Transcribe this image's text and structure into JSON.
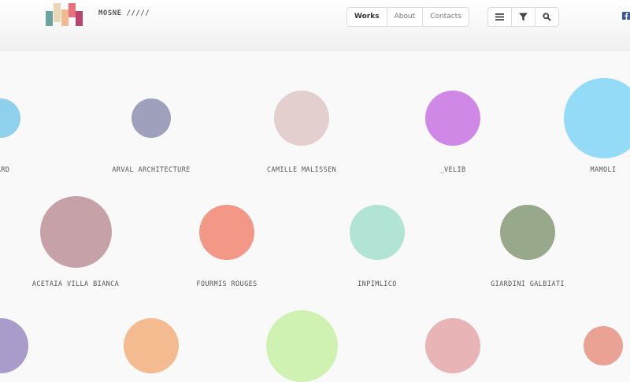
{
  "brand": {
    "name": "MOSNE /////"
  },
  "logo": {
    "colors": [
      "#6aa3a0",
      "#e8d8b8",
      "#f5b990",
      "#e9717c",
      "#b8456d"
    ]
  },
  "nav": {
    "items": [
      {
        "label": "Works",
        "active": true
      },
      {
        "label": "About",
        "active": false
      },
      {
        "label": "Contacts",
        "active": false
      }
    ]
  },
  "toolbar": {
    "menu_icon": "hamburger-icon",
    "filter_icon": "filter-icon",
    "search_icon": "search-icon"
  },
  "social": {
    "facebook_icon": "facebook-icon"
  },
  "works": [
    {
      "label": "ARD",
      "color": "#8fd0ec"
    },
    {
      "label": "ARVAL ARCHITECTURE",
      "color": "#9ea0bc"
    },
    {
      "label": "CAMILLE MALISSEN",
      "color": "#e3cfcd"
    },
    {
      "label": "_VELIB",
      "color": "#cf88e6"
    },
    {
      "label": "MAMOLI",
      "color": "#93dbf7"
    },
    {
      "label": "ACETAIA VILLA BIANCA",
      "color": "#c6a2a8"
    },
    {
      "label": "FOURMIS ROUGES",
      "color": "#f39787"
    },
    {
      "label": "INPIMLICO",
      "color": "#b1e4d4"
    },
    {
      "label": "GIARDINI GALBIATI",
      "color": "#98a88b"
    },
    {
      "label": "",
      "color": "#a99ccb"
    },
    {
      "label": "",
      "color": "#f5bb90"
    },
    {
      "label": "",
      "color": "#cff2b2"
    },
    {
      "label": "",
      "color": "#e8b4b6"
    },
    {
      "label": "",
      "color": "#e9a293"
    }
  ]
}
